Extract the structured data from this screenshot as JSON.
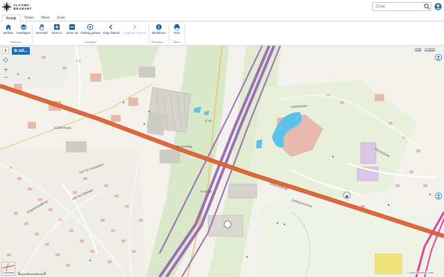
{
  "header": {
    "logo_text_line1": "VLAAMS-",
    "logo_text_line2": "BRABANT",
    "search_placeholder": "Zoek"
  },
  "tabs": [
    {
      "label": "Bekijk",
      "active": true
    },
    {
      "label": "Teken",
      "active": false
    },
    {
      "label": "Meet",
      "active": false
    },
    {
      "label": "Zoek",
      "active": false
    }
  ],
  "ribbon": {
    "buttons": [
      {
        "label": "Welkom",
        "icon": "home-icon"
      },
      {
        "label": "Kaartlagen",
        "icon": "layers-icon"
      },
      {
        "label": "Verschuif",
        "icon": "hand-icon"
      },
      {
        "label": "Zoom in",
        "icon": "zoom-in-icon"
      },
      {
        "label": "Zoom uit",
        "icon": "zoom-out-icon"
      },
      {
        "label": "Volledig gebied",
        "icon": "full-extent-icon"
      },
      {
        "label": "Vorig Gebied",
        "icon": "previous-extent-icon"
      },
      {
        "label": "Volgende Gebied",
        "icon": "next-extent-icon"
      },
      {
        "label": "Identificeer",
        "icon": "identify-icon"
      },
      {
        "label": "Print",
        "icon": "print-icon"
      }
    ],
    "groups": [
      "Startpunt",
      "Navigatie",
      "Bevragen",
      "Taken"
    ]
  },
  "map": {
    "ik_wil_label": "Ik wil...",
    "help_label": "Help",
    "contact_label": "Contact",
    "basemap_label": "Topokaart",
    "attribution": "© OpenStreetMap contr.",
    "road_labels": {
      "motorway": "A2-E314",
      "street_1": "Kolderstraat",
      "street_2": "Rooierweg",
      "street_3": "Hof Ter Kesselaan",
      "street_4": "Hof Ter Eikelaan",
      "street_5": "Engelendaalweg",
      "street_6": "Stationsstraat",
      "street_7": "Kolderbaan",
      "street_8": "Gloriestraat",
      "street_9": "Saliebeukstraat",
      "number_label": "K 81"
    }
  },
  "colors": {
    "accent": "#1d70b7",
    "main_road": "#e0693b",
    "motorway": "#9b6fb5",
    "building": "#e8b9ad",
    "water": "#5cc2e8",
    "land": "#f3f1ec"
  }
}
